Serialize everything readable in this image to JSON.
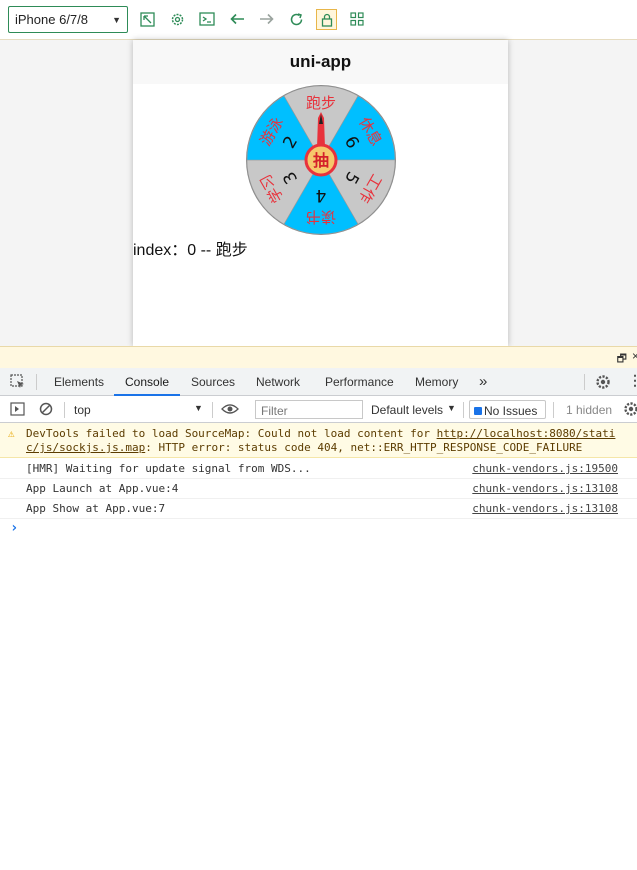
{
  "toolbar": {
    "device": "iPhone 6/7/8",
    "icons": [
      "rotate-icon",
      "gear-icon",
      "terminal-icon",
      "back-arrow-icon",
      "forward-arrow-icon",
      "reload-icon",
      "lock-icon",
      "grid-icon"
    ],
    "accent": "#2e8b57"
  },
  "app": {
    "nav_title": "uni-app",
    "index_text": "index：0 -- 跑步",
    "wheel": {
      "center": "抽",
      "segments": [
        {
          "label": "跑步",
          "number": "",
          "color": "#c8c8c8"
        },
        {
          "label": "休息",
          "number": "6",
          "color": "#00bfff"
        },
        {
          "label": "工作",
          "number": "5",
          "color": "#c8c8c8"
        },
        {
          "label": "读书",
          "number": "4",
          "color": "#00bfff"
        },
        {
          "label": "学习",
          "number": "3",
          "color": "#c8c8c8"
        },
        {
          "label": "游泳",
          "number": "2",
          "color": "#00bfff"
        }
      ]
    }
  },
  "devtools": {
    "tabs": [
      "Elements",
      "Console",
      "Sources",
      "Network",
      "Performance",
      "Memory"
    ],
    "active_tab": "Console",
    "more": "»",
    "context": "top",
    "filter_placeholder": "Filter",
    "levels": "Default levels",
    "issues": "No Issues",
    "hidden": "1 hidden",
    "warning": {
      "prefix": "DevTools failed to load SourceMap: Could not load content for ",
      "link1": "http://localhost:8080/stati",
      "link2": "c/js/sockjs.js.map",
      "rest": ": HTTP error: status code 404, net::ERR_HTTP_RESPONSE_CODE_FAILURE"
    },
    "messages": [
      {
        "text": "[HMR] Waiting for update signal from WDS...",
        "source": "chunk-vendors.js:19500"
      },
      {
        "text": "App Launch  at App.vue:4",
        "source": "chunk-vendors.js:13108"
      },
      {
        "text": "App Show  at App.vue:7",
        "source": "chunk-vendors.js:13108"
      }
    ],
    "prompt": "›"
  }
}
